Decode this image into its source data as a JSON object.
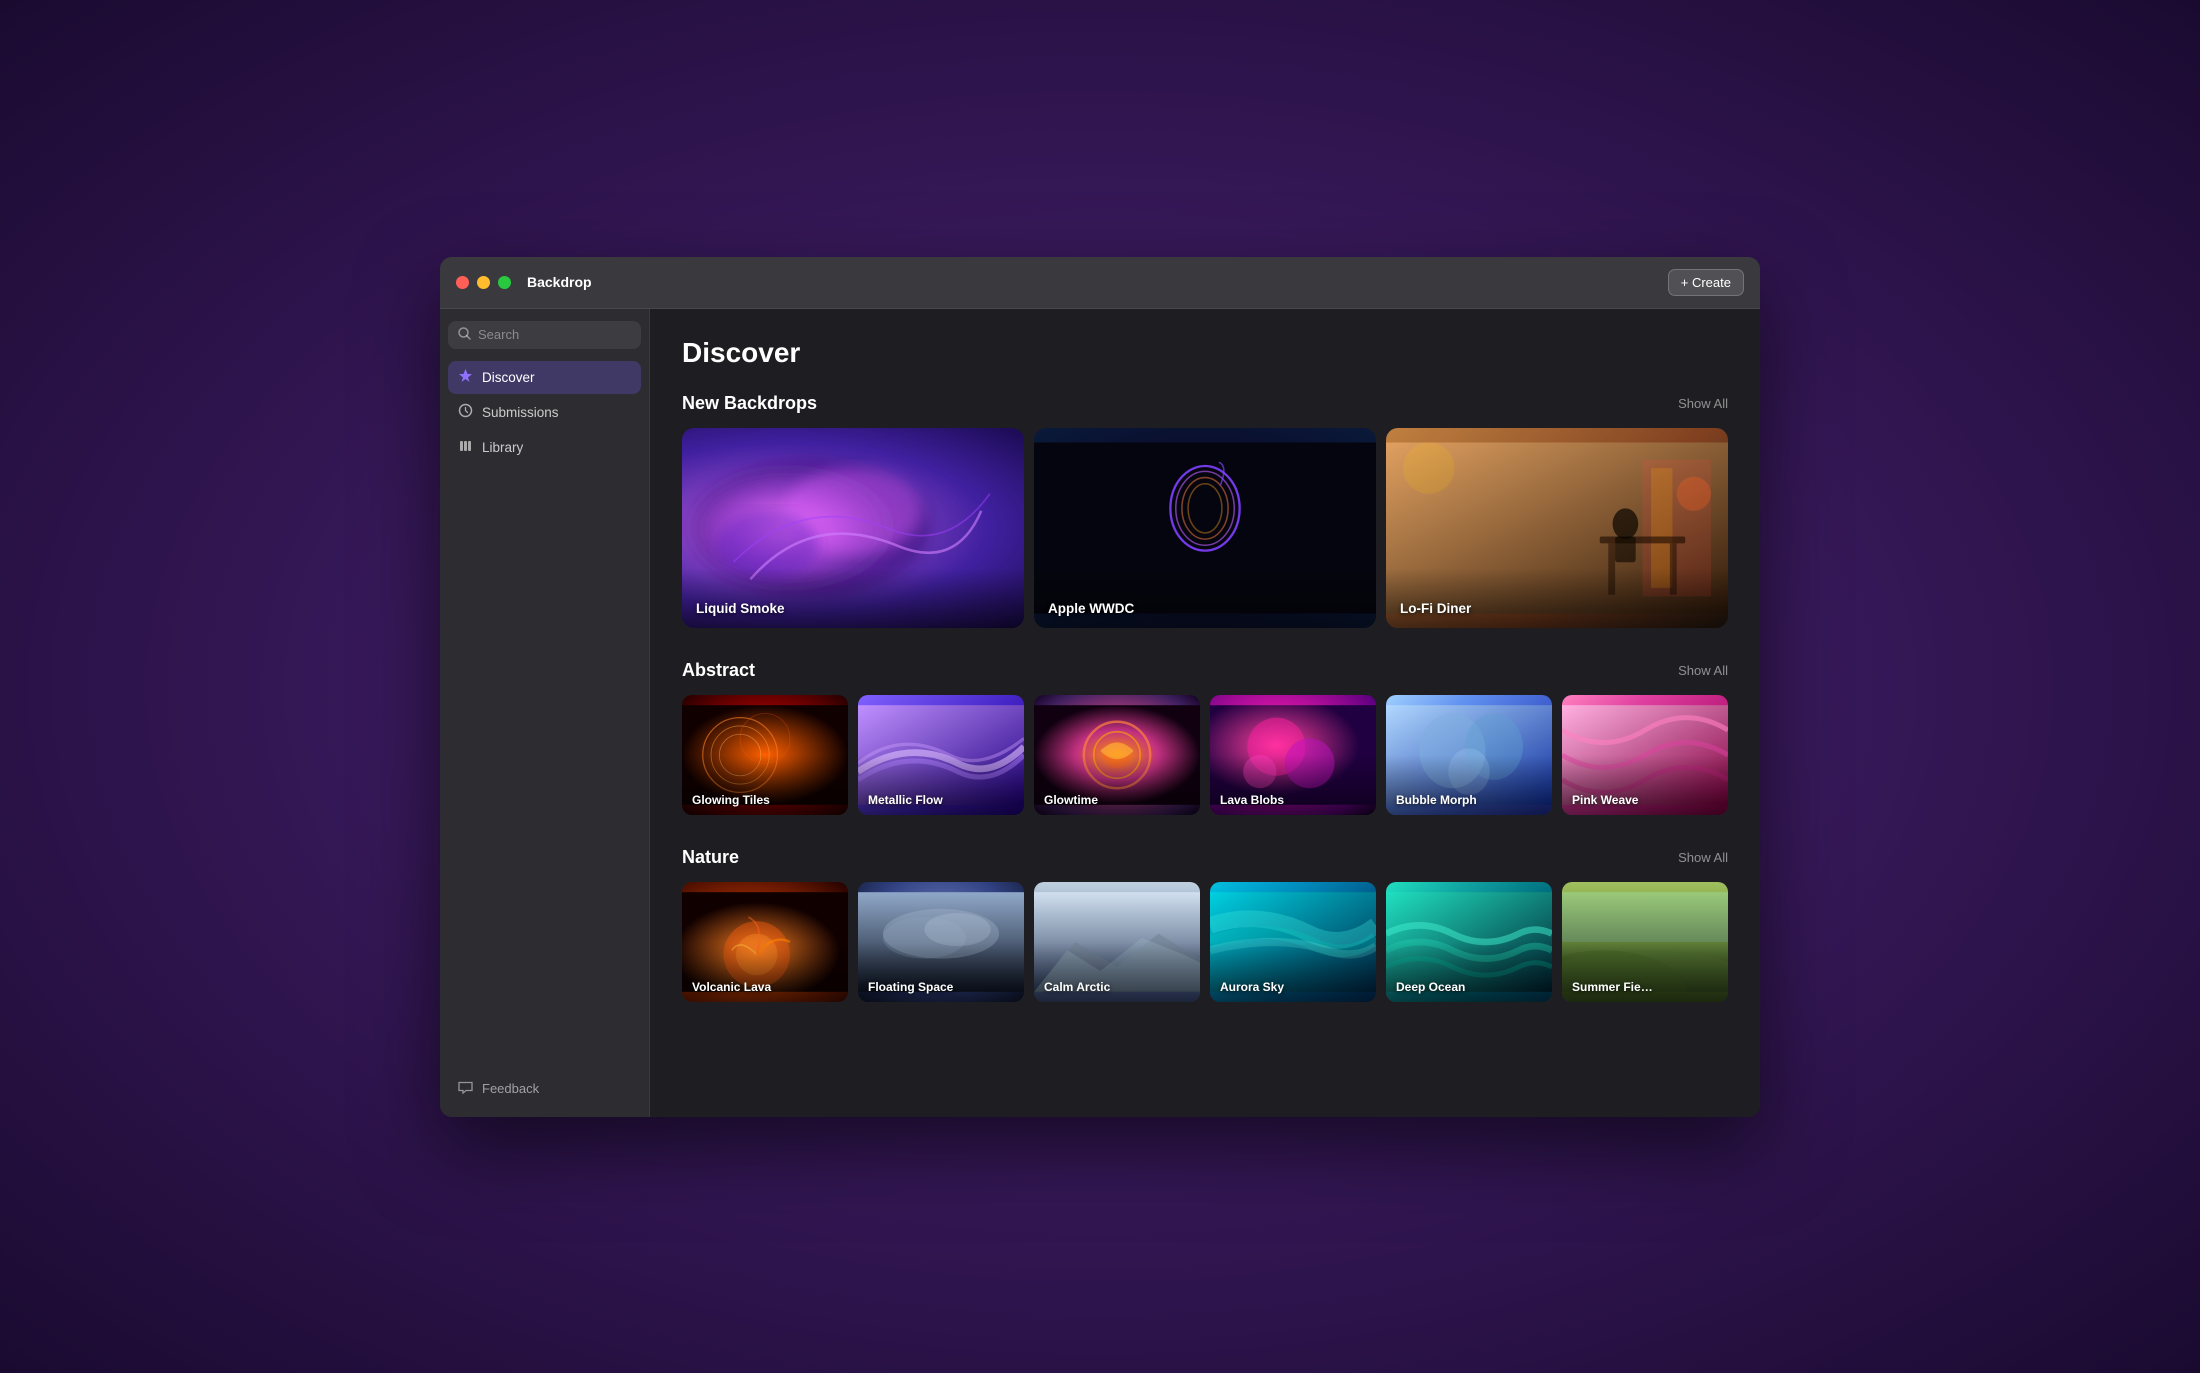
{
  "window": {
    "title": "Backdrop",
    "create_button": "+ Create"
  },
  "sidebar": {
    "search_placeholder": "Search",
    "nav_items": [
      {
        "id": "discover",
        "label": "Discover",
        "icon": "✦",
        "active": true
      },
      {
        "id": "submissions",
        "label": "Submissions",
        "icon": "↑",
        "active": false
      },
      {
        "id": "library",
        "label": "Library",
        "icon": "📖",
        "active": false
      }
    ],
    "feedback_label": "Feedback",
    "feedback_icon": "📣"
  },
  "content": {
    "page_title": "Discover",
    "sections": [
      {
        "id": "new-backdrops",
        "title": "New Backdrops",
        "show_all": "Show All",
        "cards": [
          {
            "id": "liquid-smoke",
            "label": "Liquid Smoke",
            "type": "featured",
            "bg": "liquid-smoke"
          },
          {
            "id": "apple-wwdc",
            "label": "Apple WWDC",
            "type": "featured",
            "bg": "apple-wwdc"
          },
          {
            "id": "lofi-diner",
            "label": "Lo-Fi Diner",
            "type": "featured",
            "bg": "lofi-diner"
          }
        ]
      },
      {
        "id": "abstract",
        "title": "Abstract",
        "show_all": "Show All",
        "cards": [
          {
            "id": "glowing-tiles",
            "label": "Glowing Tiles",
            "bg": "glowing-tiles"
          },
          {
            "id": "metallic-flow",
            "label": "Metallic Flow",
            "bg": "metallic-flow"
          },
          {
            "id": "glowtime",
            "label": "Glowtime",
            "bg": "glowtime"
          },
          {
            "id": "lava-blobs",
            "label": "Lava Blobs",
            "bg": "lava-blobs"
          },
          {
            "id": "bubble-morph",
            "label": "Bubble Morph",
            "bg": "bubble-morph"
          },
          {
            "id": "pink-weave",
            "label": "Pink Weave",
            "bg": "pink-weave"
          }
        ]
      },
      {
        "id": "nature",
        "title": "Nature",
        "show_all": "Show All",
        "cards": [
          {
            "id": "volcanic-lava",
            "label": "Volcanic Lava",
            "bg": "volcanic-lava"
          },
          {
            "id": "floating-space",
            "label": "Floating Space",
            "bg": "floating-space"
          },
          {
            "id": "calm-arctic",
            "label": "Calm Arctic",
            "bg": "calm-arctic"
          },
          {
            "id": "aurora-sky",
            "label": "Aurora Sky",
            "bg": "aurora-sky"
          },
          {
            "id": "deep-ocean",
            "label": "Deep Ocean",
            "bg": "deep-ocean"
          },
          {
            "id": "summer-field",
            "label": "Summer Fie…",
            "bg": "summer-field"
          }
        ]
      }
    ]
  }
}
